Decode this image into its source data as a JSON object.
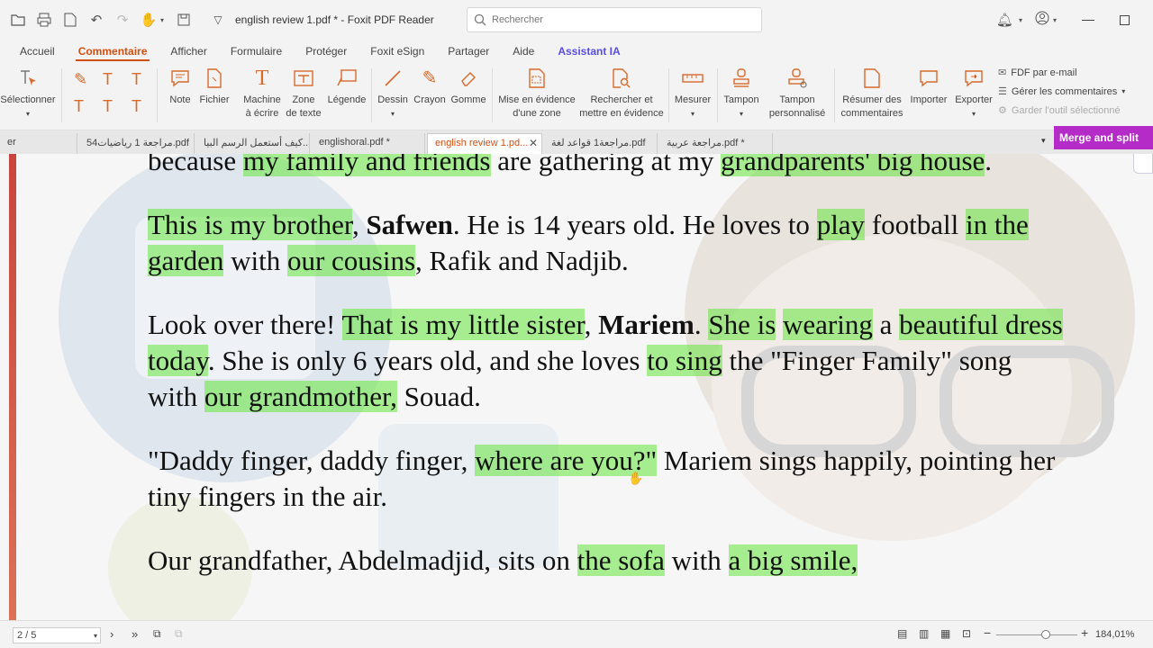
{
  "window": {
    "title": "english review 1.pdf * - Foxit PDF Reader"
  },
  "search": {
    "placeholder": "Rechercher"
  },
  "menu": [
    "Accueil",
    "Commentaire",
    "Afficher",
    "Formulaire",
    "Protéger",
    "Foxit eSign",
    "Partager",
    "Aide",
    "Assistant IA"
  ],
  "ribbon": {
    "select": "Sélectionner",
    "note": "Note",
    "file": "Fichier",
    "typewriter_1": "Machine",
    "typewriter_2": "à écrire",
    "textbox_1": "Zone",
    "textbox_2": "de texte",
    "callout": "Légende",
    "drawing": "Dessin",
    "pencil": "Crayon",
    "eraser": "Gomme",
    "highlight_area_1": "Mise en évidence",
    "highlight_area_2": "d'une zone",
    "search_highlight_1": "Rechercher et",
    "search_highlight_2": "mettre en évidence",
    "measure": "Mesurer",
    "stamp": "Tampon",
    "custom_stamp_1": "Tampon",
    "custom_stamp_2": "personnalisé",
    "summarize_1": "Résumer des",
    "summarize_2": "commentaires",
    "import": "Importer",
    "export": "Exporter",
    "fdf_email": "FDF par e-mail",
    "manage_comments": "Gérer les commentaires",
    "keep_tool": "Garder l'outil sélectionné"
  },
  "tabs": [
    {
      "label": "er"
    },
    {
      "label": "54مراجعة 1 رياضيات.pdf"
    },
    {
      "label": "كيف أستعمل الرسم البيا..."
    },
    {
      "label": "englishoral.pdf *"
    },
    {
      "label": "english review 1.pd..."
    },
    {
      "label": "مراجعة1 قواعد لغة.pdf"
    },
    {
      "label": "مراجعة عربية.pdf *"
    }
  ],
  "merge_button": "Merge and split PDFs",
  "document": {
    "p1": [
      {
        "t": "because ",
        "h": false
      },
      {
        "t": "my family and friends",
        "h": true
      },
      {
        "t": " are gathering at my ",
        "h": false
      },
      {
        "t": "grandparents' big house",
        "h": true
      },
      {
        "t": ".",
        "h": false
      }
    ],
    "p2": [
      {
        "t": "This is my brother",
        "h": true
      },
      {
        "t": ", ",
        "h": false
      },
      {
        "t": "Safwen",
        "h": false,
        "b": true
      },
      {
        "t": ". He is 14 years old. He loves to ",
        "h": false
      },
      {
        "t": "play",
        "h": true
      },
      {
        "t": " football ",
        "h": false
      },
      {
        "t": "in the garden",
        "h": true
      },
      {
        "t": " with ",
        "h": false
      },
      {
        "t": "our cousins",
        "h": true
      },
      {
        "t": ", Rafik and Nadjib.",
        "h": false
      }
    ],
    "p3": [
      {
        "t": "Look over there! ",
        "h": false
      },
      {
        "t": "That is my little sister",
        "h": true
      },
      {
        "t": ", ",
        "h": false
      },
      {
        "t": "Mariem",
        "h": false,
        "b": true
      },
      {
        "t": ". ",
        "h": false
      },
      {
        "t": "She is",
        "h": true
      },
      {
        "t": " ",
        "h": false
      },
      {
        "t": "wearing",
        "h": true
      },
      {
        "t": " a ",
        "h": false
      },
      {
        "t": "beautiful dress",
        "h": true
      },
      {
        "t": " ",
        "h": false
      },
      {
        "t": "today",
        "h": true
      },
      {
        "t": ". She is only 6 years old, and she loves ",
        "h": false
      },
      {
        "t": "to sing",
        "h": true
      },
      {
        "t": " the \"Finger Family\" song with ",
        "h": false
      },
      {
        "t": "our grandmother,",
        "h": true
      },
      {
        "t": " Souad.",
        "h": false
      }
    ],
    "p4": [
      {
        "t": "\"Daddy finger, daddy finger, ",
        "h": false
      },
      {
        "t": "where are you?\"",
        "h": true
      },
      {
        "t": " Mariem sings happily, pointing her tiny fingers in the air.",
        "h": false
      }
    ],
    "p5": [
      {
        "t": "Our grandfather, Abdelmadjid, sits on ",
        "h": false
      },
      {
        "t": "the sofa",
        "h": true
      },
      {
        "t": " with ",
        "h": false
      },
      {
        "t": "a big smile,",
        "h": true
      }
    ]
  },
  "status": {
    "page": "2 / 5",
    "zoom": "184,01%"
  },
  "colors": {
    "accent": "#d14f10",
    "highlight": "#7ee85a",
    "merge": "#b42bc8",
    "ai": "#5a4de3"
  }
}
